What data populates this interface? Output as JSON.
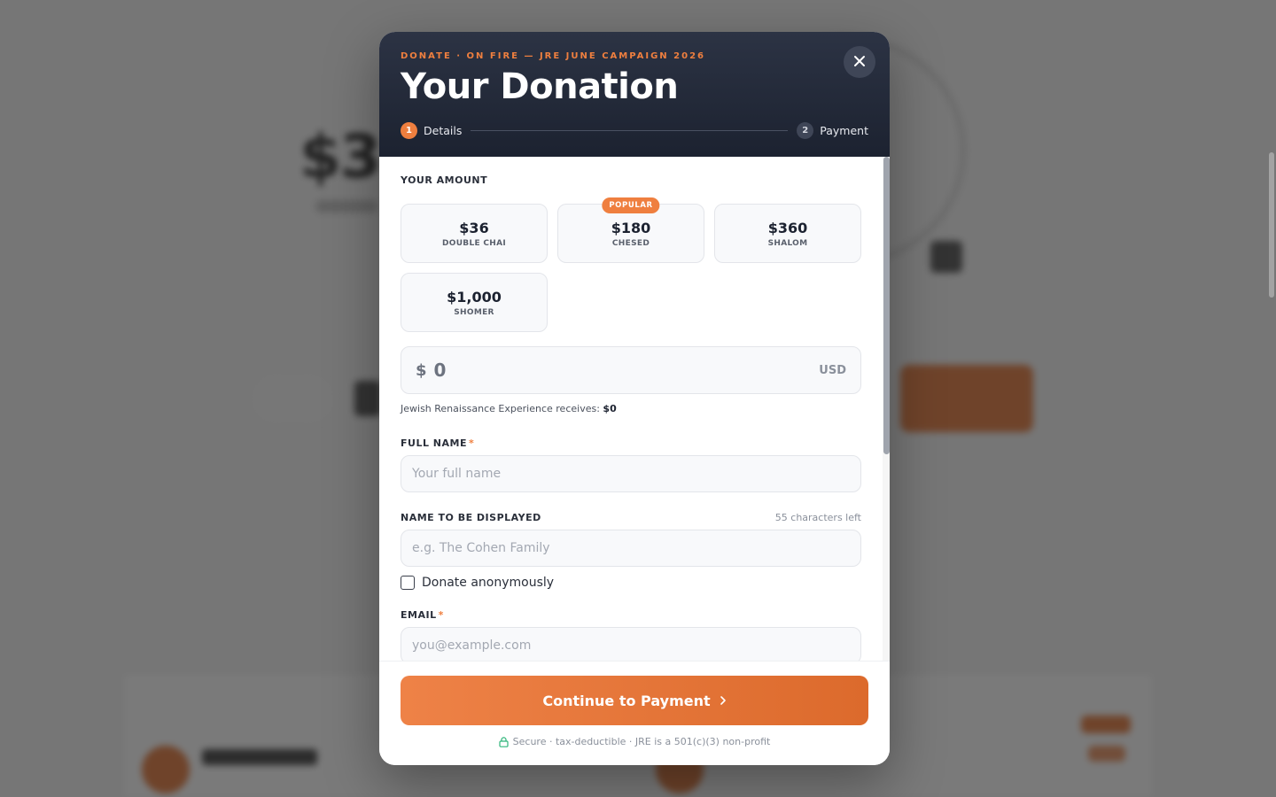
{
  "background": {
    "amount_text": "$3"
  },
  "modal": {
    "eyebrow": "DONATE · ON FIRE — JRE JUNE CAMPAIGN 2026",
    "title": "Your Donation",
    "close_icon": "close-icon",
    "steps": [
      {
        "number": "1",
        "label": "Details",
        "active": true
      },
      {
        "number": "2",
        "label": "Payment",
        "active": false
      }
    ],
    "amount_section_label": "YOUR AMOUNT",
    "amounts": [
      {
        "value": "$36",
        "name": "DOUBLE CHAI",
        "badge": ""
      },
      {
        "value": "$180",
        "name": "CHESED",
        "badge": "POPULAR"
      },
      {
        "value": "$360",
        "name": "SHALOM",
        "badge": ""
      },
      {
        "value": "$1,000",
        "name": "SHOMER",
        "badge": ""
      }
    ],
    "custom_amount": {
      "symbol": "$",
      "value": "0",
      "currency": "USD"
    },
    "receives": {
      "prefix": "Jewish Renaissance Experience receives:",
      "amount": "$0"
    },
    "full_name": {
      "label": "FULL NAME",
      "required_mark": "*",
      "placeholder": "Your full name",
      "value": ""
    },
    "display_name": {
      "label": "NAME TO BE DISPLAYED",
      "chars_left": "55 characters left",
      "placeholder": "e.g. The Cohen Family",
      "value": ""
    },
    "anonymous": {
      "label": "Donate anonymously",
      "checked": false
    },
    "email": {
      "label": "EMAIL",
      "required_mark": "*",
      "placeholder": "you@example.com",
      "value": ""
    },
    "footer": {
      "continue_label": "Continue to Payment",
      "secure_note": "Secure · tax-deductible · JRE is a 501(c)(3) non-profit"
    }
  },
  "colors": {
    "accent": "#ef7f3f",
    "header_bg": "#232a38",
    "secure_icon": "#2fb57a"
  }
}
